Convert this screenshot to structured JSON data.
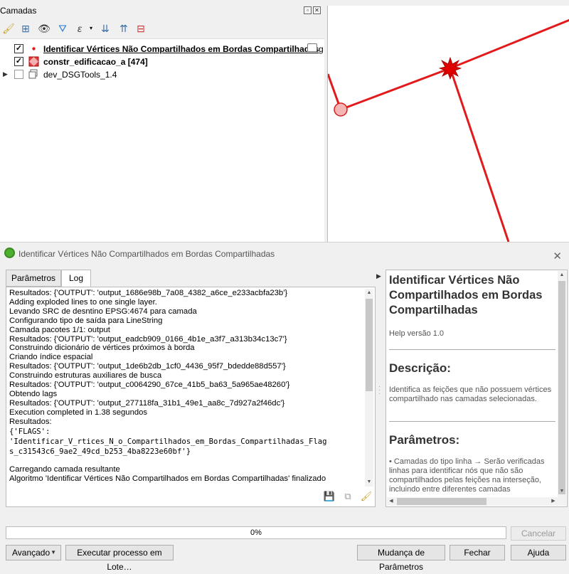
{
  "layers_panel": {
    "title": "Camadas",
    "items": [
      {
        "name": "Identificar Vértices Não Compartilhados em Bordas Compartilhadas",
        "checked": true,
        "icon": "point-layer-icon"
      },
      {
        "name": "constr_edificacao_a [474]",
        "checked": true,
        "icon": "polygon-layer-icon"
      },
      {
        "name": "dev_DSGTools_1.4",
        "checked": false,
        "icon": "group-icon"
      }
    ],
    "truncated_suffix": "g"
  },
  "dialog": {
    "title": "Identificar Vértices Não Compartilhados em Bordas Compartilhadas",
    "tabs": [
      {
        "label": "Parâmetros",
        "active": false
      },
      {
        "label": "Log",
        "active": true
      }
    ],
    "log_lines": [
      "Resultados: {'OUTPUT': 'output_1686e98b_7a08_4382_a6ce_e233acbfa23b'}",
      "Adding exploded lines to one single layer.",
      "Levando SRC de desntino EPSG:4674 para camada",
      "Configurando tipo de saída para LineString",
      "Camada pacotes 1/1: output",
      "Resultados: {'OUTPUT': 'output_eadcb909_0166_4b1e_a3f7_a313b34c13c7'}",
      "Construindo dicionário de vértices próximos à borda",
      "Criando índice espacial",
      "Resultados: {'OUTPUT': 'output_1de6b2db_1cf0_4436_95f7_bdedde88d557'}",
      "Construindo estruturas auxiliares de busca",
      "Resultados: {'OUTPUT': 'output_c0064290_67ce_41b5_ba63_5a965ae48260'}",
      "Obtendo lags",
      "Resultados: {'OUTPUT': 'output_277118fa_31b1_49e1_aa8c_7d927a2f46dc'}",
      "Execution completed in 1.38 segundos",
      "Resultados:"
    ],
    "log_mono_lines": [
      "{'FLAGS':",
      "'Identificar_V_rtices_N_o_Compartilhados_em_Bordas_Compartilhadas_Flag",
      "s_c31543c6_9ae2_49cd_b253_4ba8223e60bf'}"
    ],
    "log_tail_lines": [
      "",
      "Carregando camada resultante",
      "Algoritmo 'Identificar Vértices Não Compartilhados em Bordas Compartilhadas' finalizado"
    ],
    "help": {
      "title": "Identificar Vértices Não Compartilhados em Bordas Compartilhadas",
      "version": "Help versão 1.0",
      "description_heading": "Descrição:",
      "description": "Identifica as feições que não possuem vértices compartilhado nas camadas selecionadas.",
      "params_heading": "Parâmetros:",
      "params_text": "• Camadas do tipo linha → Serão verificadas linhas para identificar nós que não são compartilhados pelas feições na interseção, incluindo entre diferentes camadas"
    },
    "progress_text": "0%",
    "buttons": {
      "cancel": "Cancelar",
      "advanced": "Avançado",
      "batch": "Executar processo em Lote…",
      "change_params": "Mudança de Parâmetros",
      "close": "Fechar",
      "help": "Ajuda"
    }
  }
}
